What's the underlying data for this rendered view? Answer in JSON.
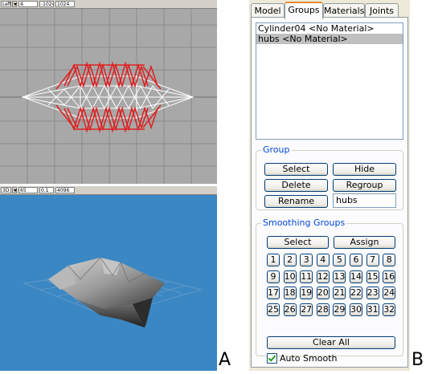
{
  "top_viewport": {
    "view_value": "Left",
    "field1": "4",
    "field2": "-1024",
    "field3": "1024",
    "background": "#a8a8a8",
    "highlight_color": "#e02020"
  },
  "bottom_viewport": {
    "view_value": "3D",
    "field1": "65",
    "field2": "0.1",
    "field3": "4096",
    "background": "#3b87c3"
  },
  "labels": {
    "left_panel": "A",
    "right_panel": "B"
  },
  "tabs": [
    {
      "label": "Model"
    },
    {
      "label": "Groups"
    },
    {
      "label": "Materials"
    },
    {
      "label": "Joints"
    }
  ],
  "groups_list": [
    {
      "label": "Cylinder04 <No Material>"
    },
    {
      "label": "hubs <No Material>"
    }
  ],
  "group_box": {
    "title": "Group",
    "select": "Select",
    "hide": "Hide",
    "delete": "Delete",
    "regroup": "Regroup",
    "rename": "Rename",
    "name_value": "hubs"
  },
  "smoothing_box": {
    "title": "Smoothing Groups",
    "select": "Select",
    "assign": "Assign",
    "numbers": [
      "1",
      "2",
      "3",
      "4",
      "5",
      "6",
      "7",
      "8",
      "9",
      "10",
      "11",
      "12",
      "13",
      "14",
      "15",
      "16",
      "17",
      "18",
      "19",
      "20",
      "21",
      "22",
      "23",
      "24",
      "25",
      "26",
      "27",
      "28",
      "29",
      "30",
      "31",
      "32"
    ],
    "clear_all": "Clear All",
    "auto_smooth": "Auto Smooth"
  }
}
